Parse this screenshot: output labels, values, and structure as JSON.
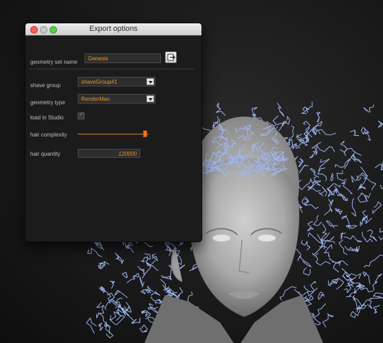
{
  "window": {
    "title": "Export options"
  },
  "form": {
    "geometry_set_name": {
      "label": "geometry set name",
      "value": "Genesis"
    },
    "shave_group": {
      "label": "shave group",
      "selected": "shaveGroup#1"
    },
    "geometry_type": {
      "label": "geometry type",
      "selected": "RenderMan"
    },
    "load_in_studio": {
      "label": "load in Studio",
      "checked": true
    },
    "hair_complexity": {
      "label": "hair complexity",
      "level": 0.97
    },
    "hair_quantity": {
      "label": "hair quantity",
      "value": "120000"
    }
  },
  "colors": {
    "accent": "#e89630",
    "hair": "#9fb6f2",
    "panel": "#1b1b1b"
  },
  "icons": {
    "export": "export-icon",
    "check": "checkmark-icon",
    "dropdown": "chevron-down-icon"
  }
}
